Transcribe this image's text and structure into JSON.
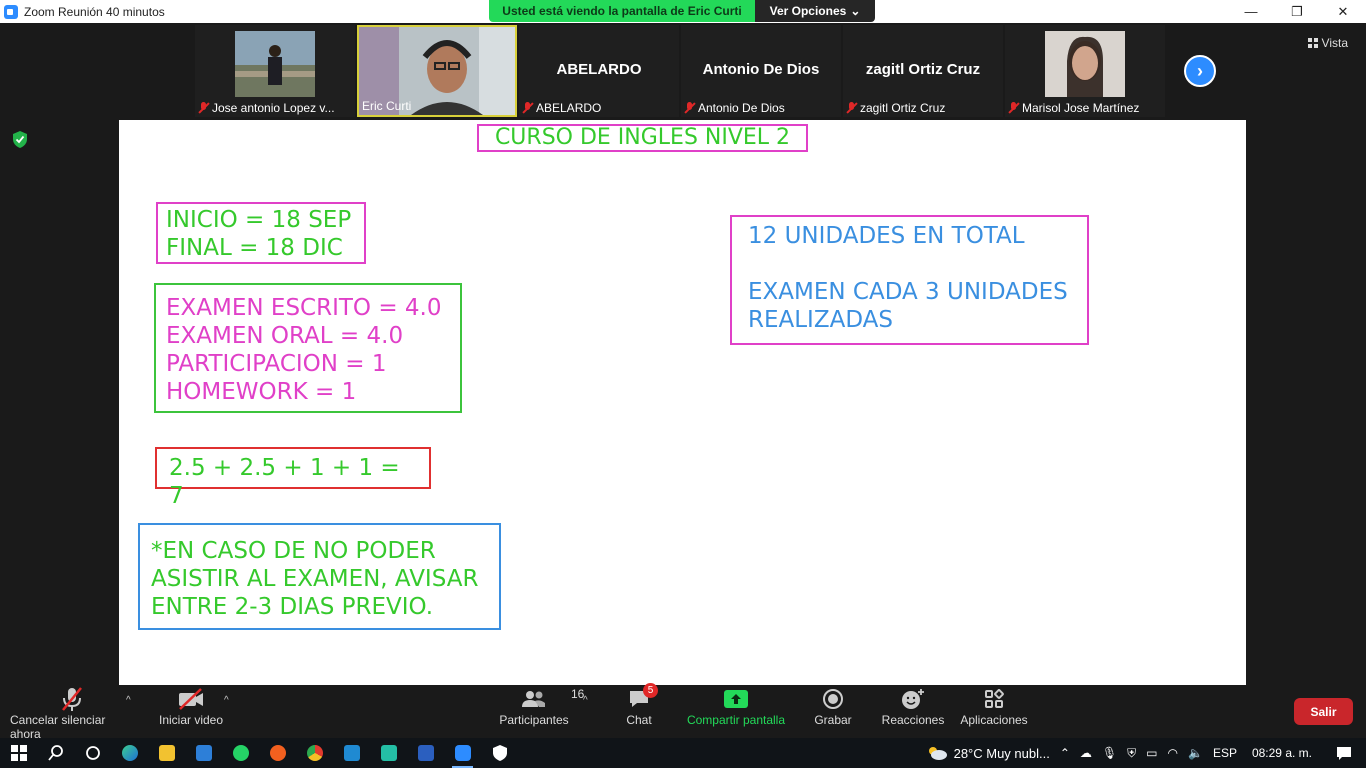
{
  "window": {
    "title": "Zoom Reunión 40 minutos",
    "minimize": "—",
    "maximize": "❐",
    "close": "✕"
  },
  "banner": {
    "viewing": "Usted está viendo la pantalla de Eric Curti",
    "options": "Ver Opciones"
  },
  "view_label": "Vista",
  "participants": [
    {
      "name": "Jose antonio Lopez v...",
      "big_name": "",
      "muted": true
    },
    {
      "name": "Eric Curti",
      "big_name": "",
      "muted": false,
      "active": true
    },
    {
      "name": "ABELARDO",
      "big_name": "ABELARDO",
      "muted": true
    },
    {
      "name": "Antonio De Dios",
      "big_name": "Antonio De Dios",
      "muted": true
    },
    {
      "name": "zagitl Ortiz Cruz",
      "big_name": "zagitl Ortiz Cruz",
      "muted": true
    },
    {
      "name": "Marisol Jose Martínez",
      "big_name": "",
      "muted": true
    }
  ],
  "slide": {
    "title": "CURSO DE INGLES NIVEL 2",
    "dates": [
      "INICIO = 18 SEP",
      "FINAL = 18 DIC"
    ],
    "grades": [
      "EXAMEN ESCRITO = 4.0",
      "EXAMEN ORAL = 4.0",
      "PARTICIPACION = 1",
      "HOMEWORK = 1"
    ],
    "sum": "2.5 + 2.5 + 1 + 1 = 7",
    "notice": [
      "*EN CASO DE NO PODER",
      "ASISTIR AL EXAMEN, AVISAR",
      "ENTRE 2-3 DIAS PREVIO."
    ],
    "units_line1": "12 UNIDADES EN TOTAL",
    "units_line2": "EXAMEN CADA 3 UNIDADES",
    "units_line3": "REALIZADAS"
  },
  "toolbar": {
    "unmute": "Cancelar silenciar ahora",
    "start_video": "Iniciar video",
    "participants": "Participantes",
    "participants_count": "16",
    "chat": "Chat",
    "chat_badge": "5",
    "share_screen": "Compartir pantalla",
    "record": "Grabar",
    "reactions": "Reacciones",
    "apps": "Aplicaciones",
    "leave": "Salir"
  },
  "taskbar": {
    "weather": "28°C  Muy nubl...",
    "lang": "ESP",
    "time": "08:29 a. m."
  },
  "colors": {
    "zoom_blue": "#2d8cff",
    "share_green": "#23d959",
    "leave_red": "#c9262b",
    "slide_green": "#35c92c",
    "slide_magenta": "#e040c8",
    "slide_blue": "#3a8fe0"
  }
}
